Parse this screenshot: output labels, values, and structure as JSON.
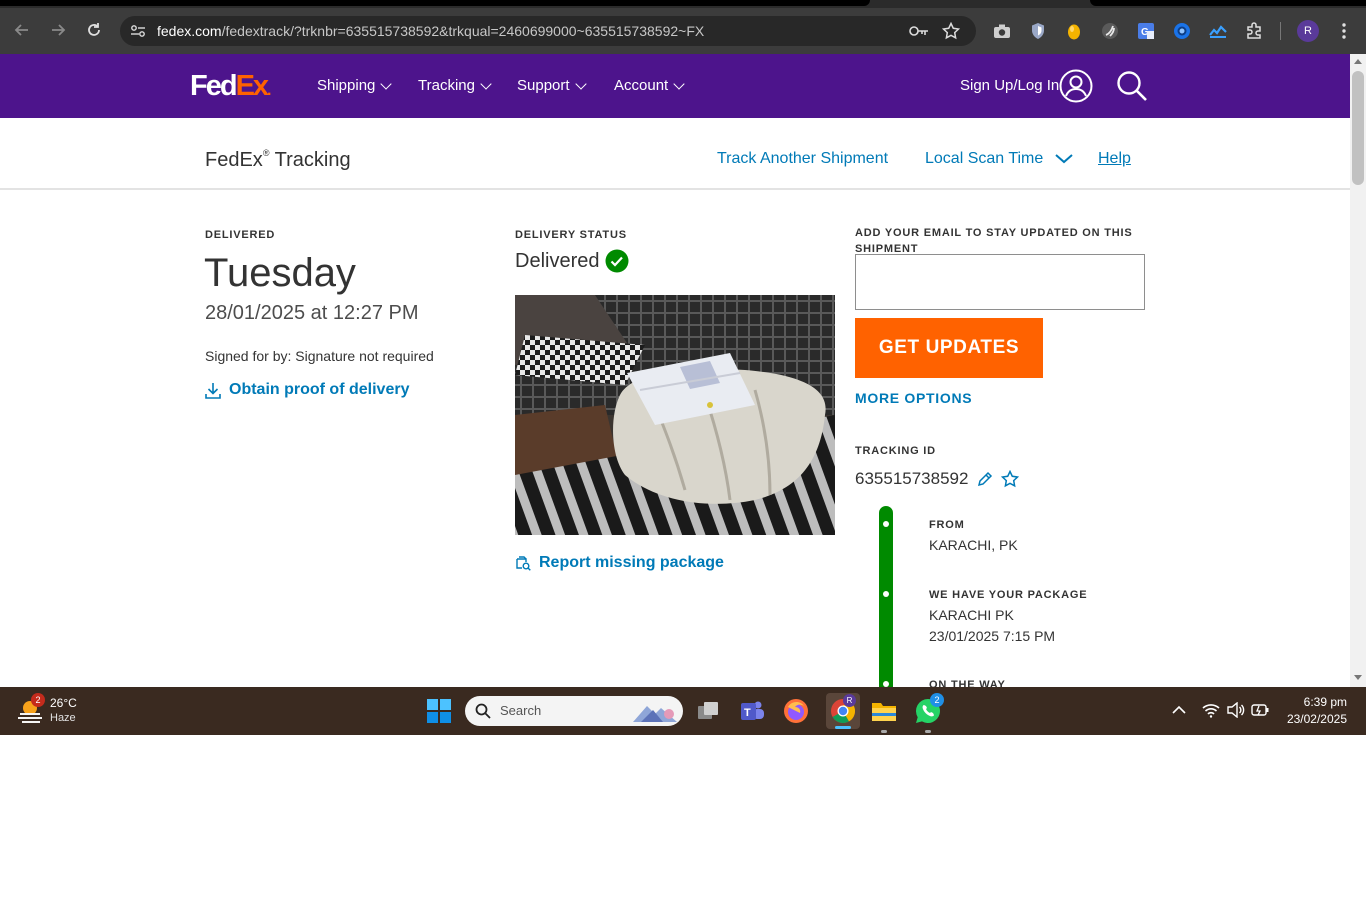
{
  "browser": {
    "url_host": "fedex.com",
    "url_path": "/fedextrack/?trknbr=635515738592&trkqual=2460699000~635515738592~FX",
    "profile_initial": "R"
  },
  "header": {
    "logo_fed": "Fed",
    "logo_ex": "Ex",
    "logo_dot": ".",
    "nav": [
      {
        "label": "Shipping"
      },
      {
        "label": "Tracking"
      },
      {
        "label": "Support"
      },
      {
        "label": "Account"
      }
    ],
    "signup_label": "Sign Up/Log In"
  },
  "subheader": {
    "title": "FedEx",
    "title_reg": "®",
    "title_suffix": " Tracking",
    "track_another": "Track Another Shipment",
    "local_scan": "Local Scan Time",
    "help": "Help"
  },
  "delivery": {
    "status_label": "DELIVERED",
    "day": "Tuesday",
    "datetime": "28/01/2025 at 12:27 PM",
    "signed_for": "Signed for by: Signature not required",
    "proof_link": "Obtain proof of delivery"
  },
  "status": {
    "label": "DELIVERY STATUS",
    "value": "Delivered",
    "report_link": "Report missing package"
  },
  "updates": {
    "email_label": "ADD YOUR EMAIL TO STAY UPDATED ON THIS SHIPMENT",
    "email_value": "",
    "button": "GET UPDATES",
    "more_options": "MORE OPTIONS"
  },
  "tracking": {
    "label": "TRACKING ID",
    "id": "635515738592",
    "events": [
      {
        "title": "FROM",
        "line1": "KARACHI, PK",
        "line2": ""
      },
      {
        "title": "WE HAVE YOUR PACKAGE",
        "line1": "KARACHI PK",
        "line2": "23/01/2025 7:15 PM"
      },
      {
        "title": "ON THE WAY",
        "line1": "",
        "line2": ""
      }
    ]
  },
  "taskbar": {
    "weather_temp": "26°C",
    "weather_desc": "Haze",
    "weather_badge": "2",
    "search_placeholder": "Search",
    "chrome_profile": "R",
    "whatsapp_badge": "2",
    "time": "6:39 pm",
    "date": "23/02/2025"
  }
}
